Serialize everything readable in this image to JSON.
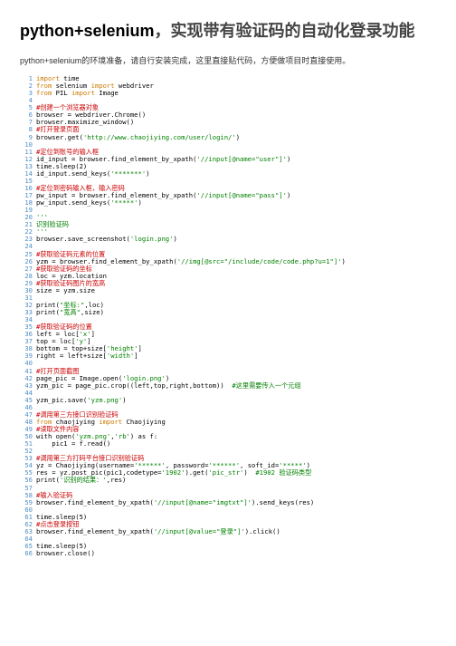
{
  "title_part1": "python+selenium",
  "title_part2": "，实现带有验证码的自动化登录功能",
  "intro": "python+selenium的环境准备，请自行安装完成，这里直接贴代码，方便做项目时直接使用。",
  "lines": [
    {
      "n": 1,
      "seg": [
        {
          "c": "kw",
          "t": "import"
        },
        {
          "c": "black",
          "t": " time"
        }
      ]
    },
    {
      "n": 2,
      "seg": [
        {
          "c": "kw",
          "t": "from"
        },
        {
          "c": "black",
          "t": " selenium "
        },
        {
          "c": "kw",
          "t": "import"
        },
        {
          "c": "black",
          "t": " webdriver"
        }
      ]
    },
    {
      "n": 3,
      "seg": [
        {
          "c": "kw",
          "t": "from"
        },
        {
          "c": "black",
          "t": " PIL "
        },
        {
          "c": "kw",
          "t": "import"
        },
        {
          "c": "black",
          "t": " Image"
        }
      ]
    },
    {
      "n": 4,
      "seg": []
    },
    {
      "n": 5,
      "seg": [
        {
          "c": "red",
          "t": "#创建一个浏览器对象"
        }
      ]
    },
    {
      "n": 6,
      "seg": [
        {
          "c": "black",
          "t": "browser = webdriver.Chrome()"
        }
      ]
    },
    {
      "n": 7,
      "seg": [
        {
          "c": "black",
          "t": "browser.maximize_window()"
        }
      ]
    },
    {
      "n": 8,
      "seg": [
        {
          "c": "red",
          "t": "#打开登录页面"
        }
      ]
    },
    {
      "n": 9,
      "seg": [
        {
          "c": "black",
          "t": "browser.get("
        },
        {
          "c": "str",
          "t": "'http://www.chaojiying.com/user/login/'"
        },
        {
          "c": "black",
          "t": ")"
        }
      ]
    },
    {
      "n": 10,
      "seg": []
    },
    {
      "n": 11,
      "seg": [
        {
          "c": "red",
          "t": "#定位到账号的输入框"
        }
      ]
    },
    {
      "n": 12,
      "seg": [
        {
          "c": "black",
          "t": "id_input = browser.find_element_by_xpath("
        },
        {
          "c": "str",
          "t": "'//input[@name=\"user\"]'"
        },
        {
          "c": "black",
          "t": ")"
        }
      ]
    },
    {
      "n": 13,
      "seg": [
        {
          "c": "black",
          "t": "time.sleep(2)"
        }
      ]
    },
    {
      "n": 14,
      "seg": [
        {
          "c": "black",
          "t": "id_input.send_keys("
        },
        {
          "c": "str",
          "t": "'*******'"
        },
        {
          "c": "black",
          "t": ")"
        }
      ]
    },
    {
      "n": 15,
      "seg": []
    },
    {
      "n": 16,
      "seg": [
        {
          "c": "red",
          "t": "#定位到密码输入框，输入密码"
        }
      ]
    },
    {
      "n": 17,
      "seg": [
        {
          "c": "black",
          "t": "pw_input = browser.find_element_by_xpath("
        },
        {
          "c": "str",
          "t": "'//input[@name=\"pass\"]'"
        },
        {
          "c": "black",
          "t": ")"
        }
      ]
    },
    {
      "n": 18,
      "seg": [
        {
          "c": "black",
          "t": "pw_input.send_keys("
        },
        {
          "c": "str",
          "t": "'*****'"
        },
        {
          "c": "black",
          "t": ")"
        }
      ]
    },
    {
      "n": 19,
      "seg": []
    },
    {
      "n": 20,
      "seg": [
        {
          "c": "str",
          "t": "'''"
        }
      ]
    },
    {
      "n": 21,
      "seg": [
        {
          "c": "str",
          "t": "识别验证码"
        }
      ]
    },
    {
      "n": 22,
      "seg": [
        {
          "c": "str",
          "t": "'''"
        }
      ]
    },
    {
      "n": 23,
      "seg": [
        {
          "c": "black",
          "t": "browser.save_screenshot("
        },
        {
          "c": "str",
          "t": "'login.png'"
        },
        {
          "c": "black",
          "t": ")"
        }
      ]
    },
    {
      "n": 24,
      "seg": []
    },
    {
      "n": 25,
      "seg": [
        {
          "c": "red",
          "t": "#获取验证码元素的位置"
        }
      ]
    },
    {
      "n": 26,
      "seg": [
        {
          "c": "black",
          "t": "yzm = browser.find_element_by_xpath("
        },
        {
          "c": "str",
          "t": "'//img[@src=\"/include/code/code.php?u=1\"]'"
        },
        {
          "c": "black",
          "t": ")"
        }
      ]
    },
    {
      "n": 27,
      "seg": [
        {
          "c": "red",
          "t": "#获取验证码的坐标"
        }
      ]
    },
    {
      "n": 28,
      "seg": [
        {
          "c": "black",
          "t": "loc = yzm.location"
        }
      ]
    },
    {
      "n": 29,
      "seg": [
        {
          "c": "red",
          "t": "#获取验证码图片的宽高"
        }
      ]
    },
    {
      "n": 30,
      "seg": [
        {
          "c": "black",
          "t": "size = yzm.size"
        }
      ]
    },
    {
      "n": 31,
      "seg": []
    },
    {
      "n": 32,
      "seg": [
        {
          "c": "black",
          "t": "print("
        },
        {
          "c": "str",
          "t": "\"坐标:\""
        },
        {
          "c": "black",
          "t": ",loc)"
        }
      ]
    },
    {
      "n": 33,
      "seg": [
        {
          "c": "black",
          "t": "print("
        },
        {
          "c": "str",
          "t": "\"宽高\""
        },
        {
          "c": "black",
          "t": ",size)"
        }
      ]
    },
    {
      "n": 34,
      "seg": []
    },
    {
      "n": 35,
      "seg": [
        {
          "c": "red",
          "t": "#获取验证码的位置"
        }
      ]
    },
    {
      "n": 36,
      "seg": [
        {
          "c": "black",
          "t": "left = loc["
        },
        {
          "c": "str",
          "t": "'x'"
        },
        {
          "c": "black",
          "t": "]"
        }
      ]
    },
    {
      "n": 37,
      "seg": [
        {
          "c": "black",
          "t": "top = loc["
        },
        {
          "c": "str",
          "t": "'y'"
        },
        {
          "c": "black",
          "t": "]"
        }
      ]
    },
    {
      "n": 38,
      "seg": [
        {
          "c": "black",
          "t": "bottom = top+size["
        },
        {
          "c": "str",
          "t": "'height'"
        },
        {
          "c": "black",
          "t": "]"
        }
      ]
    },
    {
      "n": 39,
      "seg": [
        {
          "c": "black",
          "t": "right = left+size["
        },
        {
          "c": "str",
          "t": "'width'"
        },
        {
          "c": "black",
          "t": "]"
        }
      ]
    },
    {
      "n": 40,
      "seg": []
    },
    {
      "n": 41,
      "seg": [
        {
          "c": "red",
          "t": "#打开页面截图"
        }
      ]
    },
    {
      "n": 42,
      "seg": [
        {
          "c": "black",
          "t": "page_pic = Image.open("
        },
        {
          "c": "str",
          "t": "'login.png'"
        },
        {
          "c": "black",
          "t": ")"
        }
      ]
    },
    {
      "n": 43,
      "seg": [
        {
          "c": "black",
          "t": "yzm_pic = page_pic.crop((left,top,right,bottom))  "
        },
        {
          "c": "cm",
          "t": "#这里需要传入一个元组"
        }
      ]
    },
    {
      "n": 44,
      "seg": []
    },
    {
      "n": 45,
      "seg": [
        {
          "c": "black",
          "t": "yzm_pic.save("
        },
        {
          "c": "str",
          "t": "'yzm.png'"
        },
        {
          "c": "black",
          "t": ")"
        }
      ]
    },
    {
      "n": 46,
      "seg": []
    },
    {
      "n": 47,
      "seg": [
        {
          "c": "red",
          "t": "#调用第三方接口识别验证码"
        }
      ]
    },
    {
      "n": 48,
      "seg": [
        {
          "c": "kw",
          "t": "from"
        },
        {
          "c": "black",
          "t": " chaojiying "
        },
        {
          "c": "kw",
          "t": "import"
        },
        {
          "c": "black",
          "t": " Chaojiying"
        }
      ]
    },
    {
      "n": 49,
      "seg": [
        {
          "c": "red",
          "t": "#读取文件内容"
        }
      ]
    },
    {
      "n": 50,
      "seg": [
        {
          "c": "black",
          "t": "with open("
        },
        {
          "c": "str",
          "t": "'yzm.png'"
        },
        {
          "c": "black",
          "t": ","
        },
        {
          "c": "str",
          "t": "'rb'"
        },
        {
          "c": "black",
          "t": ") as f:"
        }
      ]
    },
    {
      "n": 51,
      "seg": [
        {
          "c": "black",
          "t": "    pic1 = f.read()"
        }
      ]
    },
    {
      "n": 52,
      "seg": []
    },
    {
      "n": 53,
      "seg": [
        {
          "c": "red",
          "t": "#调用第三方打码平台接口识别验证码"
        }
      ]
    },
    {
      "n": 54,
      "seg": [
        {
          "c": "black",
          "t": "yz = Chaojiying(username="
        },
        {
          "c": "str",
          "t": "'******'"
        },
        {
          "c": "black",
          "t": ", password="
        },
        {
          "c": "str",
          "t": "'******'"
        },
        {
          "c": "black",
          "t": ", soft_id="
        },
        {
          "c": "str",
          "t": "'*****'"
        },
        {
          "c": "black",
          "t": ")"
        }
      ]
    },
    {
      "n": 55,
      "seg": [
        {
          "c": "black",
          "t": "res = yz.post_pic(pic1,codetype="
        },
        {
          "c": "str",
          "t": "'1902'"
        },
        {
          "c": "black",
          "t": ").get("
        },
        {
          "c": "str",
          "t": "'pic_str'"
        },
        {
          "c": "black",
          "t": ")  "
        },
        {
          "c": "cm",
          "t": "#1902 验证码类型"
        }
      ]
    },
    {
      "n": 56,
      "seg": [
        {
          "c": "black",
          "t": "print("
        },
        {
          "c": "str",
          "t": "'识别的结果：'"
        },
        {
          "c": "black",
          "t": ",res)"
        }
      ]
    },
    {
      "n": 57,
      "seg": []
    },
    {
      "n": 58,
      "seg": [
        {
          "c": "red",
          "t": "#输入验证码"
        }
      ]
    },
    {
      "n": 59,
      "seg": [
        {
          "c": "black",
          "t": "browser.find_element_by_xpath("
        },
        {
          "c": "str",
          "t": "'//input[@name=\"imgtxt\"]'"
        },
        {
          "c": "black",
          "t": ").send_keys(res)"
        }
      ]
    },
    {
      "n": 60,
      "seg": []
    },
    {
      "n": 61,
      "seg": [
        {
          "c": "black",
          "t": "time.sleep(5)"
        }
      ]
    },
    {
      "n": 62,
      "seg": [
        {
          "c": "red",
          "t": "#点击登录按钮"
        }
      ]
    },
    {
      "n": 63,
      "seg": [
        {
          "c": "black",
          "t": "browser.find_element_by_xpath("
        },
        {
          "c": "str",
          "t": "'//input[@value=\"登录\"]'"
        },
        {
          "c": "black",
          "t": ").click()"
        }
      ]
    },
    {
      "n": 64,
      "seg": []
    },
    {
      "n": 65,
      "seg": [
        {
          "c": "black",
          "t": "time.sleep(5)"
        }
      ]
    },
    {
      "n": 66,
      "seg": [
        {
          "c": "black",
          "t": "browser.close()"
        }
      ]
    }
  ]
}
